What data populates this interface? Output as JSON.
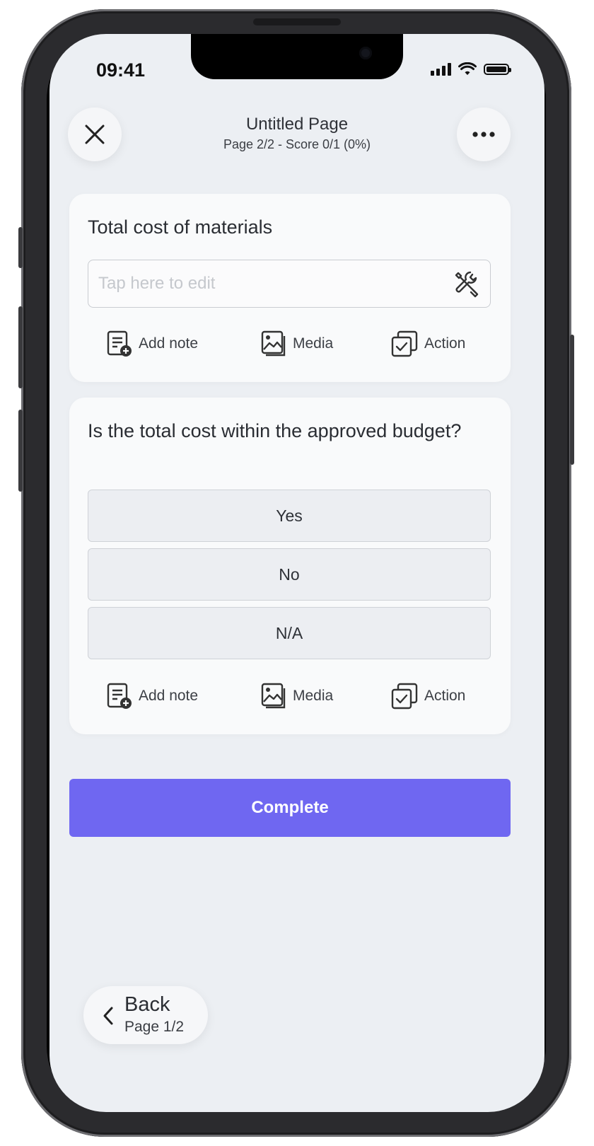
{
  "status_bar": {
    "time": "09:41"
  },
  "header": {
    "title": "Untitled Page",
    "subtitle": "Page 2/2 - Score 0/1 (0%)"
  },
  "questions": [
    {
      "title": "Total cost of materials",
      "input_placeholder": "Tap here to edit",
      "actions": {
        "add_note": "Add note",
        "media": "Media",
        "action": "Action"
      }
    },
    {
      "title": "Is the total cost within the approved budget?",
      "options": [
        "Yes",
        "No",
        "N/A"
      ],
      "actions": {
        "add_note": "Add note",
        "media": "Media",
        "action": "Action"
      }
    }
  ],
  "complete_button": "Complete",
  "back": {
    "label": "Back",
    "page": "Page 1/2"
  },
  "colors": {
    "accent": "#6f67f1",
    "screen_bg": "#eceff3",
    "card_bg": "#f9fafb"
  }
}
